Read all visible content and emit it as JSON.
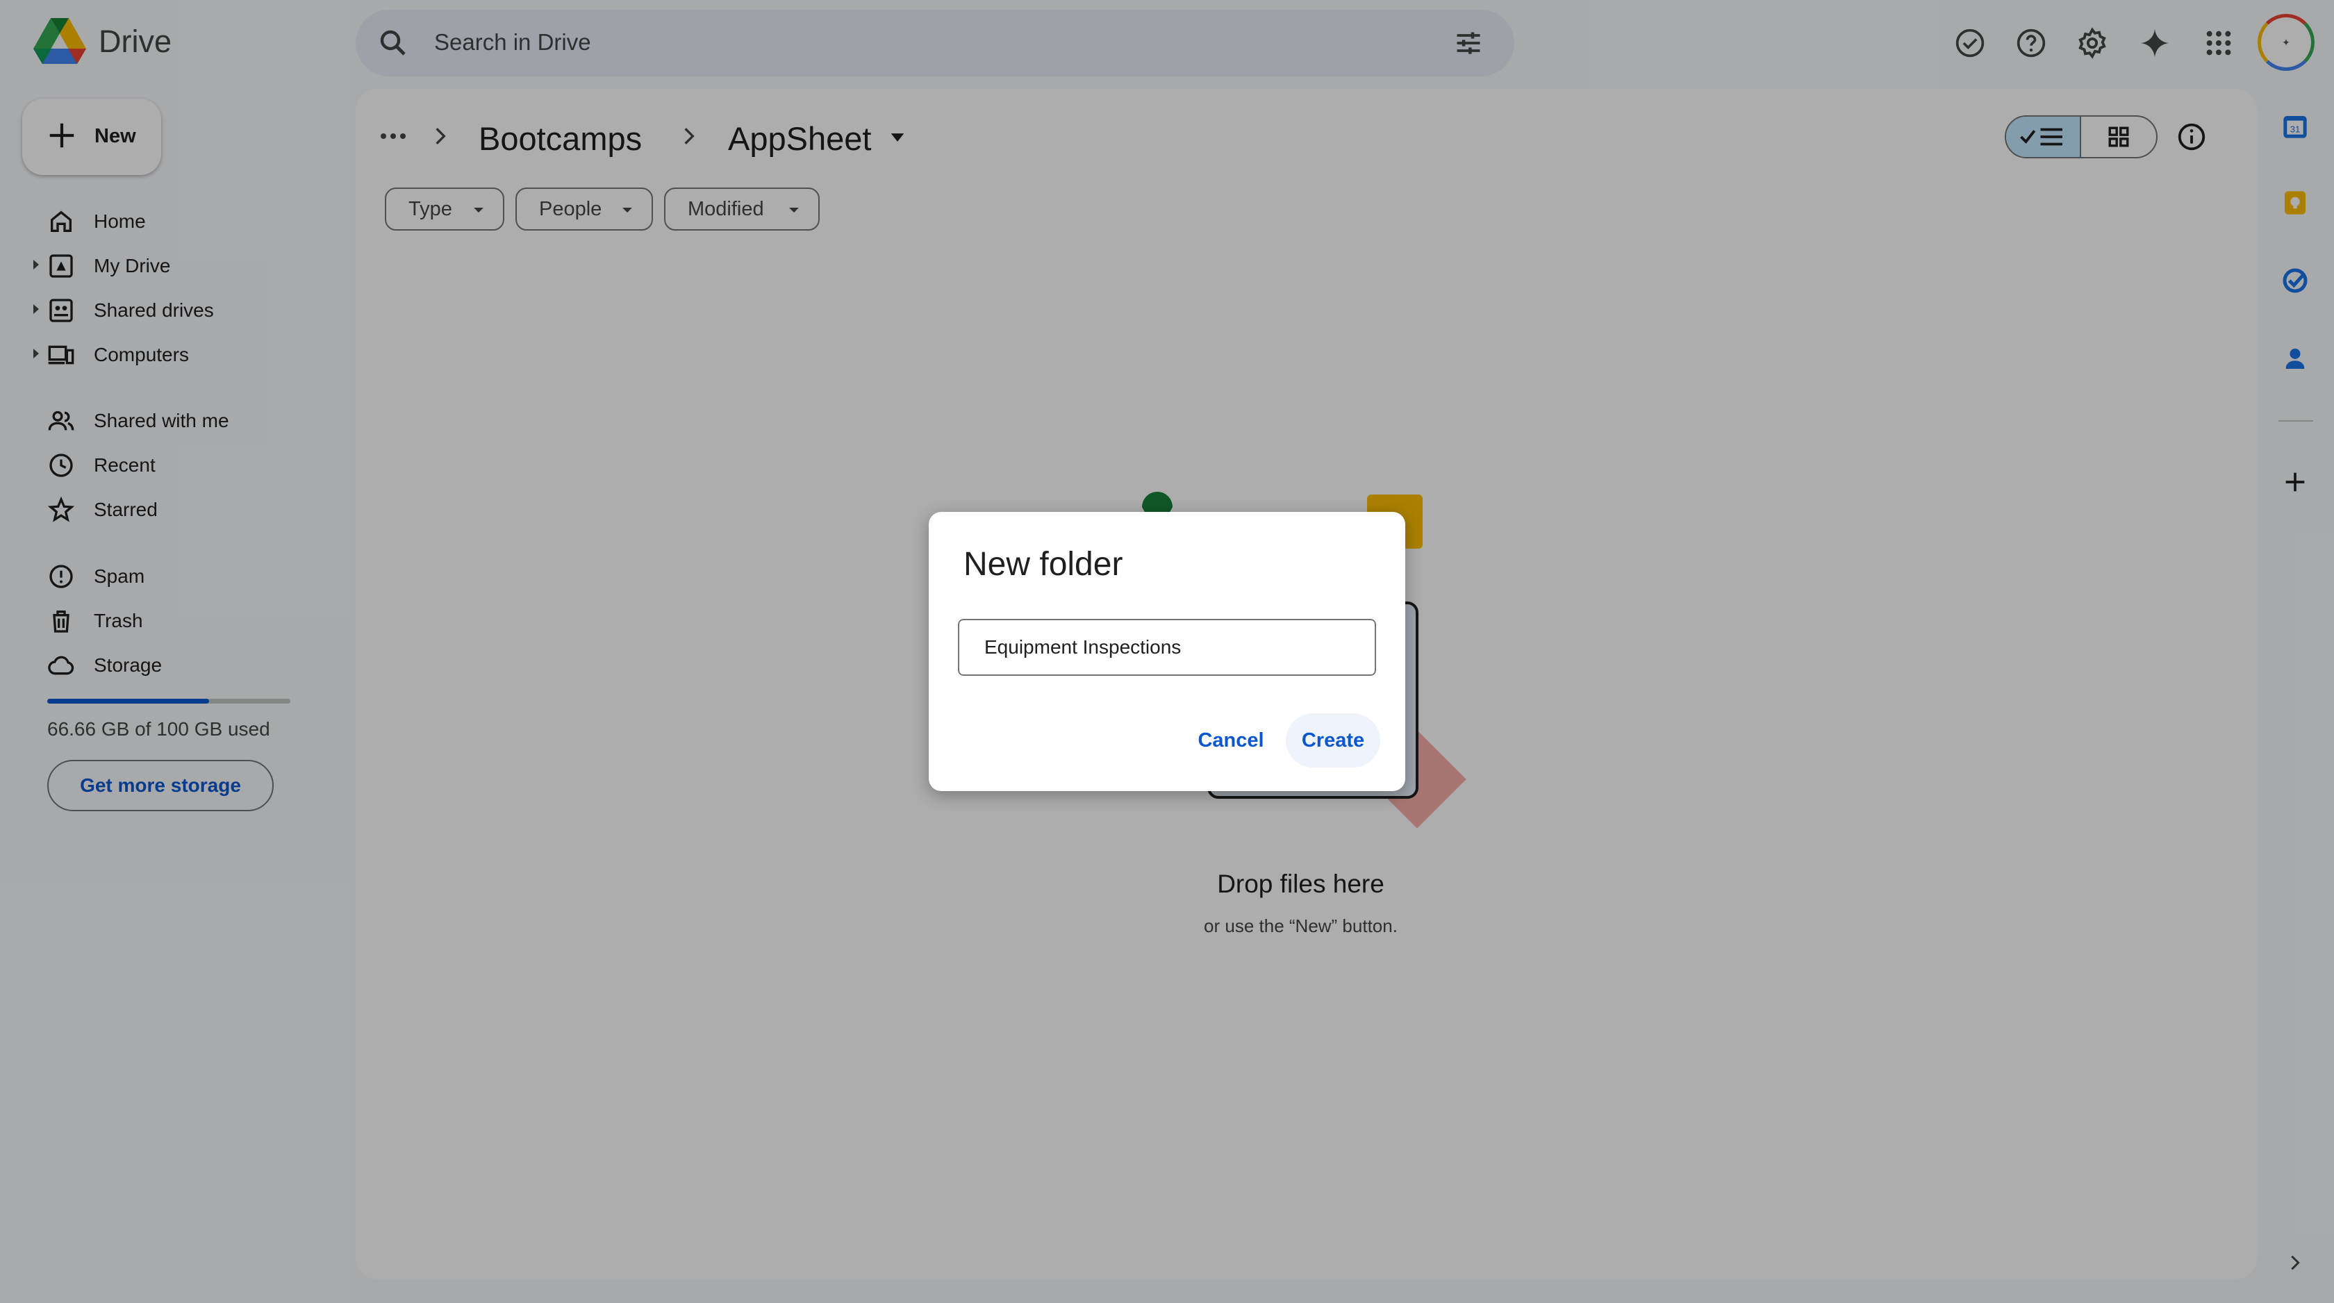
{
  "app": {
    "name": "Drive"
  },
  "search": {
    "placeholder": "Search in Drive"
  },
  "header_icons": [
    "offline-ready-icon",
    "help-icon",
    "settings-icon",
    "gemini-sparkle-icon",
    "apps-grid-icon",
    "account-avatar"
  ],
  "sidebar": {
    "new_label": "New",
    "items": [
      {
        "label": "Home",
        "icon": "home-icon",
        "expandable": false
      },
      {
        "label": "My Drive",
        "icon": "my-drive-icon",
        "expandable": true
      },
      {
        "label": "Shared drives",
        "icon": "shared-drives-icon",
        "expandable": true
      },
      {
        "label": "Computers",
        "icon": "computers-icon",
        "expandable": true
      },
      {
        "label": "Shared with me",
        "icon": "people-icon",
        "expandable": false
      },
      {
        "label": "Recent",
        "icon": "clock-icon",
        "expandable": false
      },
      {
        "label": "Starred",
        "icon": "star-icon",
        "expandable": false
      },
      {
        "label": "Spam",
        "icon": "spam-icon",
        "expandable": false
      },
      {
        "label": "Trash",
        "icon": "trash-icon",
        "expandable": false
      },
      {
        "label": "Storage",
        "icon": "cloud-icon",
        "expandable": false
      }
    ],
    "storage": {
      "used_fraction": 0.6666,
      "text": "66.66 GB of 100 GB used",
      "button": "Get more storage"
    }
  },
  "breadcrumb": {
    "parent": "Bootcamps",
    "current": "AppSheet"
  },
  "filters": [
    "Type",
    "People",
    "Modified"
  ],
  "view_mode": "list",
  "empty_state": {
    "title": "Drop files here",
    "subtitle": "or use the “New” button."
  },
  "right_rail": [
    "calendar-icon",
    "keep-icon",
    "tasks-icon",
    "contacts-icon",
    "add-icon"
  ],
  "dialog": {
    "title": "New folder",
    "input_value": "Equipment Inspections",
    "cancel": "Cancel",
    "create": "Create"
  },
  "colors": {
    "accent": "#0b57d0",
    "background": "#f8fafd",
    "toggle_selected": "#c2e7ff"
  }
}
